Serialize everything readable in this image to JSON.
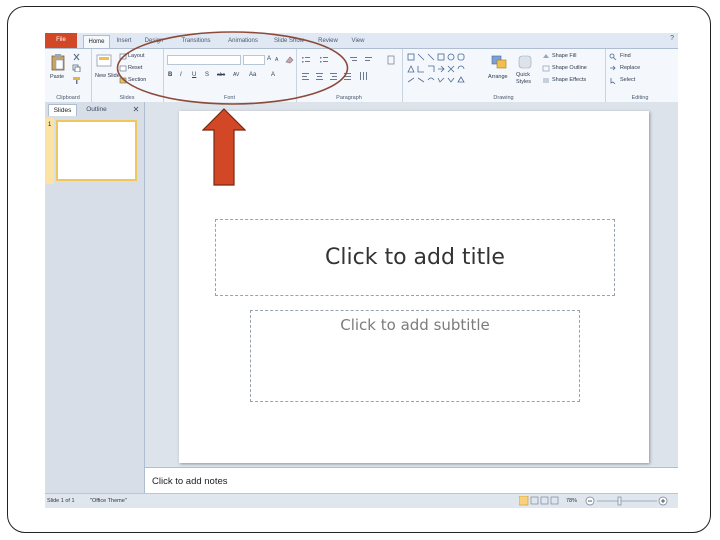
{
  "tabs": [
    "File",
    "Home",
    "Insert",
    "Design",
    "Transitions",
    "Animations",
    "Slide Show",
    "Review",
    "View"
  ],
  "groups": {
    "clipboard": {
      "label": "Clipboard",
      "paste": "Paste"
    },
    "slides": {
      "label": "Slides",
      "new_slide": "New Slide",
      "layout": "Layout",
      "reset": "Reset",
      "section": "Section"
    },
    "font": {
      "label": "Font",
      "font_name": "",
      "font_size": "",
      "bold": "B",
      "italic": "I",
      "underline": "U",
      "strike": "S",
      "spacing": "abc",
      "shadow": "AV",
      "case": "Aa",
      "color": "A",
      "grow": "A",
      "shrink": "A"
    },
    "paragraph": {
      "label": "Paragraph"
    },
    "drawing": {
      "label": "Drawing",
      "arrange": "Arrange",
      "quick_styles": "Quick Styles",
      "shape_fill": "Shape Fill",
      "shape_outline": "Shape Outline",
      "shape_effects": "Shape Effects"
    },
    "editing": {
      "label": "Editing",
      "find": "Find",
      "replace": "Replace",
      "select": "Select"
    }
  },
  "pane": {
    "tab_slides": "Slides",
    "tab_outline": "Outline",
    "close": "✕",
    "slide_number": "1"
  },
  "slide": {
    "title_placeholder": "Click to add title",
    "subtitle_placeholder": "Click to add subtitle"
  },
  "notes_placeholder": "Click to add notes",
  "status": {
    "slide_info": "Slide 1 of 1",
    "theme": "\"Office Theme\"",
    "zoom": "78%"
  },
  "annotation": {
    "arrow_color": "#d24726",
    "oval_color": "#8b4a3a"
  }
}
